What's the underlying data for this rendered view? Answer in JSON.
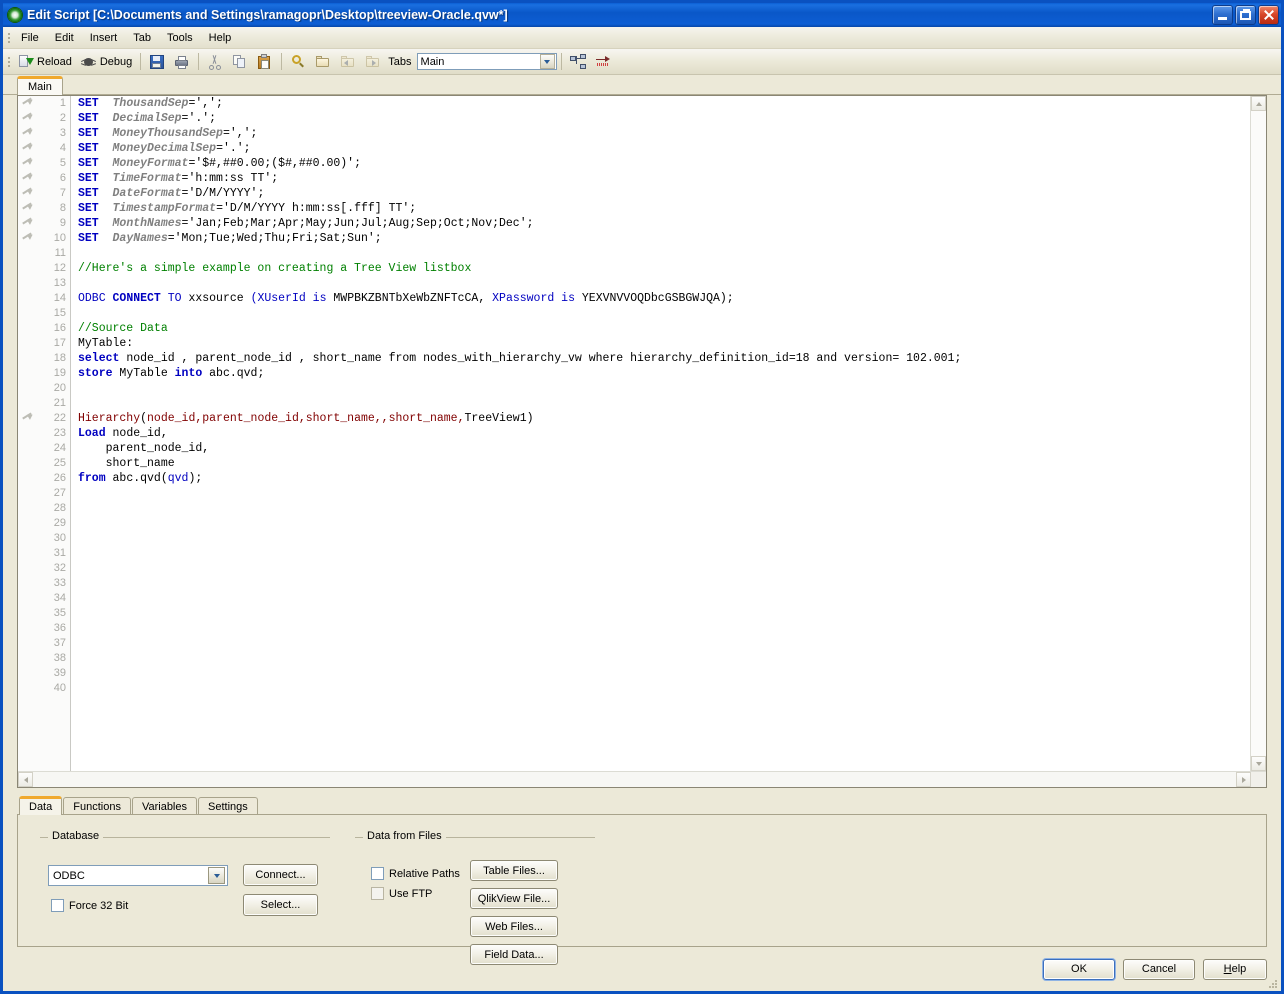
{
  "window": {
    "title": "Edit Script [C:\\Documents and Settings\\ramagopr\\Desktop\\treeview-Oracle.qvw*]",
    "icon": "qlikview-icon",
    "minimize_label": "Minimize",
    "maximize_label": "Restore",
    "close_label": "Close"
  },
  "menubar": {
    "items": [
      {
        "label": "File"
      },
      {
        "label": "Edit"
      },
      {
        "label": "Insert"
      },
      {
        "label": "Tab"
      },
      {
        "label": "Tools"
      },
      {
        "label": "Help"
      }
    ]
  },
  "toolbar": {
    "reload_label": "Reload",
    "debug_label": "Debug",
    "save_label": "Save",
    "print_label": "Print",
    "cut_label": "Cut",
    "copy_label": "Copy",
    "paste_label": "Paste",
    "search_label": "Search",
    "open_label": "Open",
    "prev_label": "Previous Tab",
    "next_label": "Next Tab",
    "tabs_label": "Tabs",
    "tab_value": "Main",
    "promote_label": "Promote Tab",
    "comment_label": "Comment"
  },
  "script_tabs": [
    {
      "label": "Main",
      "active": true
    }
  ],
  "editor": {
    "lines": [
      {
        "n": 1,
        "mark": true,
        "tokens": [
          {
            "t": "SET",
            "c": "kw"
          },
          {
            "t": "  ",
            "c": "plain"
          },
          {
            "t": "ThousandSep",
            "c": "var"
          },
          {
            "t": "=',';",
            "c": "plain"
          }
        ]
      },
      {
        "n": 2,
        "mark": true,
        "tokens": [
          {
            "t": "SET",
            "c": "kw"
          },
          {
            "t": "  ",
            "c": "plain"
          },
          {
            "t": "DecimalSep",
            "c": "var"
          },
          {
            "t": "='.';",
            "c": "plain"
          }
        ]
      },
      {
        "n": 3,
        "mark": true,
        "tokens": [
          {
            "t": "SET",
            "c": "kw"
          },
          {
            "t": "  ",
            "c": "plain"
          },
          {
            "t": "MoneyThousandSep",
            "c": "var"
          },
          {
            "t": "=',';",
            "c": "plain"
          }
        ]
      },
      {
        "n": 4,
        "mark": true,
        "tokens": [
          {
            "t": "SET",
            "c": "kw"
          },
          {
            "t": "  ",
            "c": "plain"
          },
          {
            "t": "MoneyDecimalSep",
            "c": "var"
          },
          {
            "t": "='.';",
            "c": "plain"
          }
        ]
      },
      {
        "n": 5,
        "mark": true,
        "tokens": [
          {
            "t": "SET",
            "c": "kw"
          },
          {
            "t": "  ",
            "c": "plain"
          },
          {
            "t": "MoneyFormat",
            "c": "var"
          },
          {
            "t": "='$#,##0.00;($#,##0.00)';",
            "c": "plain"
          }
        ]
      },
      {
        "n": 6,
        "mark": true,
        "tokens": [
          {
            "t": "SET",
            "c": "kw"
          },
          {
            "t": "  ",
            "c": "plain"
          },
          {
            "t": "TimeFormat",
            "c": "var"
          },
          {
            "t": "='h:mm:ss TT';",
            "c": "plain"
          }
        ]
      },
      {
        "n": 7,
        "mark": true,
        "tokens": [
          {
            "t": "SET",
            "c": "kw"
          },
          {
            "t": "  ",
            "c": "plain"
          },
          {
            "t": "DateFormat",
            "c": "var"
          },
          {
            "t": "='D/M/YYYY';",
            "c": "plain"
          }
        ]
      },
      {
        "n": 8,
        "mark": true,
        "tokens": [
          {
            "t": "SET",
            "c": "kw"
          },
          {
            "t": "  ",
            "c": "plain"
          },
          {
            "t": "TimestampFormat",
            "c": "var"
          },
          {
            "t": "='D/M/YYYY h:mm:ss[.fff] TT';",
            "c": "plain"
          }
        ]
      },
      {
        "n": 9,
        "mark": true,
        "tokens": [
          {
            "t": "SET",
            "c": "kw"
          },
          {
            "t": "  ",
            "c": "plain"
          },
          {
            "t": "MonthNames",
            "c": "var"
          },
          {
            "t": "='Jan;Feb;Mar;Apr;May;Jun;Jul;Aug;Sep;Oct;Nov;Dec';",
            "c": "plain"
          }
        ]
      },
      {
        "n": 10,
        "mark": true,
        "tokens": [
          {
            "t": "SET",
            "c": "kw"
          },
          {
            "t": "  ",
            "c": "plain"
          },
          {
            "t": "DayNames",
            "c": "var"
          },
          {
            "t": "='Mon;Tue;Wed;Thu;Fri;Sat;Sun';",
            "c": "plain"
          }
        ]
      },
      {
        "n": 11,
        "mark": false,
        "tokens": []
      },
      {
        "n": 12,
        "mark": false,
        "tokens": [
          {
            "t": "//Here's a simple example on creating a Tree View listbox",
            "c": "cmt"
          }
        ]
      },
      {
        "n": 13,
        "mark": false,
        "tokens": []
      },
      {
        "n": 14,
        "mark": false,
        "tokens": [
          {
            "t": "ODBC ",
            "c": "kw2"
          },
          {
            "t": "CONNECT",
            "c": "kw"
          },
          {
            "t": " TO",
            "c": "kw2"
          },
          {
            "t": " xxsource ",
            "c": "plain"
          },
          {
            "t": "(",
            "c": "kw2"
          },
          {
            "t": "XUserId",
            "c": "kw2"
          },
          {
            "t": " is",
            "c": "kw2"
          },
          {
            "t": " MWPBKZBNTbXeWbZNFTcCA, ",
            "c": "plain"
          },
          {
            "t": "XPassword",
            "c": "kw2"
          },
          {
            "t": " is",
            "c": "kw2"
          },
          {
            "t": " YEXVNVVOQDbcGSBGWJQA);",
            "c": "plain"
          }
        ]
      },
      {
        "n": 15,
        "mark": false,
        "tokens": []
      },
      {
        "n": 16,
        "mark": false,
        "tokens": [
          {
            "t": "//Source Data",
            "c": "cmt"
          }
        ]
      },
      {
        "n": 17,
        "mark": false,
        "tokens": [
          {
            "t": "MyTable:",
            "c": "plain"
          }
        ]
      },
      {
        "n": 18,
        "mark": false,
        "tokens": [
          {
            "t": "select",
            "c": "kw"
          },
          {
            "t": " node_id , parent_node_id , short_name from nodes_with_hierarchy_vw where hierarchy_definition_id=18 and version= 102.001;",
            "c": "plain"
          }
        ]
      },
      {
        "n": 19,
        "mark": false,
        "tokens": [
          {
            "t": "store",
            "c": "kw"
          },
          {
            "t": " MyTable ",
            "c": "plain"
          },
          {
            "t": "into",
            "c": "kw"
          },
          {
            "t": " abc.qvd;",
            "c": "plain"
          }
        ]
      },
      {
        "n": 20,
        "mark": false,
        "tokens": []
      },
      {
        "n": 21,
        "mark": false,
        "tokens": []
      },
      {
        "n": 22,
        "mark": true,
        "tokens": [
          {
            "t": "Hierarchy",
            "c": "fn"
          },
          {
            "t": "(",
            "c": "plain"
          },
          {
            "t": "node_id,parent_node_id,short_name,,short_name,",
            "c": "arg"
          },
          {
            "t": "TreeView1)",
            "c": "plain"
          }
        ]
      },
      {
        "n": 23,
        "mark": false,
        "tokens": [
          {
            "t": "Load",
            "c": "kw"
          },
          {
            "t": " node_id,",
            "c": "plain"
          }
        ]
      },
      {
        "n": 24,
        "mark": false,
        "tokens": [
          {
            "t": "    parent_node_id,",
            "c": "plain"
          }
        ]
      },
      {
        "n": 25,
        "mark": false,
        "tokens": [
          {
            "t": "    short_name",
            "c": "plain"
          }
        ]
      },
      {
        "n": 26,
        "mark": false,
        "tokens": [
          {
            "t": "from",
            "c": "kw"
          },
          {
            "t": " abc.qvd(",
            "c": "plain"
          },
          {
            "t": "qvd",
            "c": "kw2"
          },
          {
            "t": ");",
            "c": "plain"
          }
        ]
      },
      {
        "n": 27,
        "mark": false,
        "tokens": []
      },
      {
        "n": 28,
        "mark": false,
        "tokens": []
      },
      {
        "n": 29,
        "mark": false,
        "tokens": []
      },
      {
        "n": 30,
        "mark": false,
        "tokens": []
      },
      {
        "n": 31,
        "mark": false,
        "tokens": []
      },
      {
        "n": 32,
        "mark": false,
        "tokens": []
      },
      {
        "n": 33,
        "mark": false,
        "tokens": []
      },
      {
        "n": 34,
        "mark": false,
        "tokens": []
      },
      {
        "n": 35,
        "mark": false,
        "tokens": []
      },
      {
        "n": 36,
        "mark": false,
        "tokens": []
      },
      {
        "n": 37,
        "mark": false,
        "tokens": []
      },
      {
        "n": 38,
        "mark": false,
        "tokens": []
      },
      {
        "n": 39,
        "mark": false,
        "tokens": []
      },
      {
        "n": 40,
        "mark": false,
        "tokens": []
      }
    ]
  },
  "lower_panel": {
    "tabs": [
      {
        "label": "Data",
        "active": true
      },
      {
        "label": "Functions",
        "active": false
      },
      {
        "label": "Variables",
        "active": false
      },
      {
        "label": "Settings",
        "active": false
      }
    ],
    "database": {
      "group_label": "Database",
      "driver_value": "ODBC",
      "force32_label": "Force 32 Bit",
      "force32_checked": false,
      "connect_label": "Connect...",
      "select_label": "Select..."
    },
    "data_from_files": {
      "group_label": "Data from Files",
      "relative_paths_label": "Relative Paths",
      "relative_paths_checked": false,
      "use_ftp_label": "Use FTP",
      "use_ftp_checked": false,
      "buttons": [
        {
          "label": "Table Files..."
        },
        {
          "label": "QlikView File..."
        },
        {
          "label": "Web Files..."
        },
        {
          "label": "Field Data..."
        }
      ]
    }
  },
  "footer": {
    "ok_label": "OK",
    "cancel_label": "Cancel",
    "help_label": "Help"
  },
  "colors": {
    "titlebar_blue": "#0a57c8",
    "keyword_blue": "#0000c0",
    "comment_green": "#008000",
    "variable_gray": "#808080",
    "function_maroon": "#800000",
    "tab_accent_orange": "#f0a92e",
    "dialog_face": "#ece9d8"
  }
}
